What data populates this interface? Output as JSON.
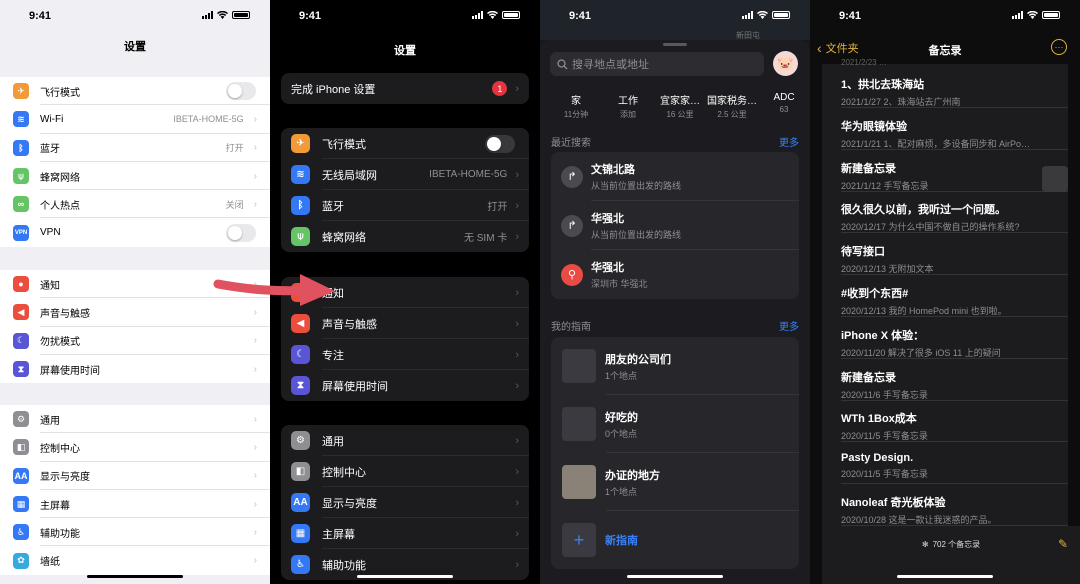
{
  "time": "9:41",
  "p1": {
    "title": "设置",
    "group1": [
      {
        "label": "飞行模式",
        "value": "",
        "icon": "airplane-icon",
        "color": "#f19a37",
        "glyph": "✈",
        "toggle": true,
        "name": "airplane"
      },
      {
        "label": "Wi-Fi",
        "value": "IBETA-HOME-5G",
        "icon": "wifi-icon",
        "color": "#3478f6",
        "glyph": "≋",
        "name": "wifi"
      },
      {
        "label": "蓝牙",
        "value": "打开",
        "icon": "bluetooth-icon",
        "color": "#3478f6",
        "glyph": "ᛒ",
        "name": "bluetooth"
      },
      {
        "label": "蜂窝网络",
        "value": "",
        "icon": "antenna-icon",
        "color": "#65c466",
        "glyph": "⍦",
        "name": "cellular"
      },
      {
        "label": "个人热点",
        "value": "关闭",
        "icon": "hotspot-icon",
        "color": "#65c466",
        "glyph": "∞",
        "name": "hotspot"
      },
      {
        "label": "VPN",
        "value": "",
        "icon": "vpn-icon",
        "color": "#3478f6",
        "glyph": "VPN",
        "toggle": true,
        "name": "vpn"
      }
    ],
    "group2": [
      {
        "label": "通知",
        "icon": "notification-icon",
        "color": "#eb4e3d",
        "glyph": "●",
        "name": "notifications"
      },
      {
        "label": "声音与触感",
        "icon": "speaker-icon",
        "color": "#eb4e3d",
        "glyph": "◀",
        "name": "sounds"
      },
      {
        "label": "勿扰模式",
        "icon": "moon-icon",
        "color": "#5856d6",
        "glyph": "☾",
        "name": "dnd"
      },
      {
        "label": "屏幕使用时间",
        "icon": "hourglass-icon",
        "color": "#5856d6",
        "glyph": "⧗",
        "name": "screentime"
      }
    ],
    "group3": [
      {
        "label": "通用",
        "icon": "gear-icon",
        "color": "#8e8e93",
        "glyph": "⚙",
        "name": "general"
      },
      {
        "label": "控制中心",
        "icon": "toggles-icon",
        "color": "#8e8e93",
        "glyph": "◧",
        "name": "control-center"
      },
      {
        "label": "显示与亮度",
        "icon": "text-size-icon",
        "color": "#3478f6",
        "glyph": "AA",
        "name": "display"
      },
      {
        "label": "主屏幕",
        "icon": "home-grid-icon",
        "color": "#3478f6",
        "glyph": "▦",
        "name": "home-screen"
      },
      {
        "label": "辅助功能",
        "icon": "accessibility-icon",
        "color": "#3478f6",
        "glyph": "♿",
        "name": "accessibility"
      },
      {
        "label": "墙纸",
        "icon": "flower-icon",
        "color": "#36aadc",
        "glyph": "✿",
        "name": "wallpaper"
      }
    ]
  },
  "p2": {
    "title": "设置",
    "setup": {
      "label": "完成 iPhone 设置",
      "badge": "1"
    },
    "group1": [
      {
        "label": "飞行模式",
        "value": "",
        "icon": "airplane-icon",
        "color": "#f19a37",
        "glyph": "✈",
        "toggle": true,
        "name": "airplane"
      },
      {
        "label": "无线局域网",
        "value": "IBETA-HOME-5G",
        "icon": "wifi-icon",
        "color": "#3478f6",
        "glyph": "≋",
        "name": "wlan"
      },
      {
        "label": "蓝牙",
        "value": "打开",
        "icon": "bluetooth-icon",
        "color": "#3478f6",
        "glyph": "ᛒ",
        "name": "bluetooth"
      },
      {
        "label": "蜂窝网络",
        "value": "无 SIM 卡",
        "icon": "antenna-icon",
        "color": "#65c466",
        "glyph": "⍦",
        "name": "cellular"
      }
    ],
    "group2": [
      {
        "label": "通知",
        "icon": "notification-icon",
        "color": "#eb4e3d",
        "glyph": "●",
        "name": "notifications"
      },
      {
        "label": "声音与触感",
        "icon": "speaker-icon",
        "color": "#eb4e3d",
        "glyph": "◀",
        "name": "sounds"
      },
      {
        "label": "专注",
        "icon": "moon-icon",
        "color": "#5856d6",
        "glyph": "☾",
        "name": "focus"
      },
      {
        "label": "屏幕使用时间",
        "icon": "hourglass-icon",
        "color": "#5856d6",
        "glyph": "⧗",
        "name": "screentime"
      }
    ],
    "group3": [
      {
        "label": "通用",
        "icon": "gear-icon",
        "color": "#8e8e93",
        "glyph": "⚙",
        "name": "general"
      },
      {
        "label": "控制中心",
        "icon": "toggles-icon",
        "color": "#8e8e93",
        "glyph": "◧",
        "name": "control-center"
      },
      {
        "label": "显示与亮度",
        "icon": "text-size-icon",
        "color": "#3478f6",
        "glyph": "AA",
        "name": "display"
      },
      {
        "label": "主屏幕",
        "icon": "home-grid-icon",
        "color": "#3478f6",
        "glyph": "▦",
        "name": "home-screen"
      },
      {
        "label": "辅助功能",
        "icon": "accessibility-icon",
        "color": "#3478f6",
        "glyph": "♿",
        "name": "accessibility"
      }
    ]
  },
  "p3": {
    "map_label": "新田屯",
    "search_placeholder": "搜寻地点或地址",
    "favorites": [
      {
        "name": "家",
        "sub": "11分钟"
      },
      {
        "name": "工作",
        "sub": "添加"
      },
      {
        "name": "宜家家…",
        "sub": "16 公里"
      },
      {
        "name": "国家税务…",
        "sub": "2.5 公里"
      },
      {
        "name": "ADC",
        "sub": "63"
      }
    ],
    "recents_title": "最近搜索",
    "more": "更多",
    "recents": [
      {
        "title": "文锦北路",
        "sub": "从当前位置出发的路线",
        "icon": "turn-arrow-icon",
        "color": "#4a4a50",
        "glyph": "↱"
      },
      {
        "title": "华强北",
        "sub": "从当前位置出发的路线",
        "icon": "turn-arrow-icon",
        "color": "#4a4a50",
        "glyph": "↱"
      },
      {
        "title": "华强北",
        "sub": "深圳市 华强北",
        "icon": "pin-icon",
        "color": "#ea4b45",
        "glyph": "⚲"
      }
    ],
    "guides_title": "我的指南",
    "guides": [
      {
        "title": "朋友的公司们",
        "sub": "1个地点"
      },
      {
        "title": "好吃的",
        "sub": "0个地点"
      },
      {
        "title": "办证的地方",
        "sub": "1个地点"
      }
    ],
    "new_guide": "新指南"
  },
  "p4": {
    "back": "文件夹",
    "title": "备忘录",
    "top_fragment": "2021/2/23 …",
    "notes": [
      {
        "title": "1、拱北去珠海站",
        "sub": "2021/1/27  2、珠海站去广州南"
      },
      {
        "title": "华为眼镜体验",
        "sub": "2021/1/21  1、配对麻烦，多设备同步和 AirPo…"
      },
      {
        "title": "新建备忘录",
        "sub": "2021/1/12  手写备忘录"
      },
      {
        "title": "很久很久以前，我听过一个问题。",
        "sub": "2020/12/17  为什么中国不做自己的操作系统?"
      },
      {
        "title": "待写接口",
        "sub": "2020/12/13  无附加文本"
      },
      {
        "title": "#收到个东西#",
        "sub": "2020/12/13  我的 HomePod mini 也到啦。"
      },
      {
        "title": "iPhone X 体验：",
        "sub": "2020/11/20  解决了很多 iOS 11 上的疑问"
      },
      {
        "title": "新建备忘录",
        "sub": "2020/11/6  手写备忘录"
      },
      {
        "title": "WTh 1Box成本",
        "sub": "2020/11/5  手写备忘录"
      },
      {
        "title": "Pasty Design.",
        "sub": "2020/11/5  手写备忘录"
      },
      {
        "title": "Nanoleaf 奇光板体验",
        "sub": "2020/10/28  这是一款让我迷惑的产品。"
      }
    ],
    "count": "702 个备忘录"
  }
}
